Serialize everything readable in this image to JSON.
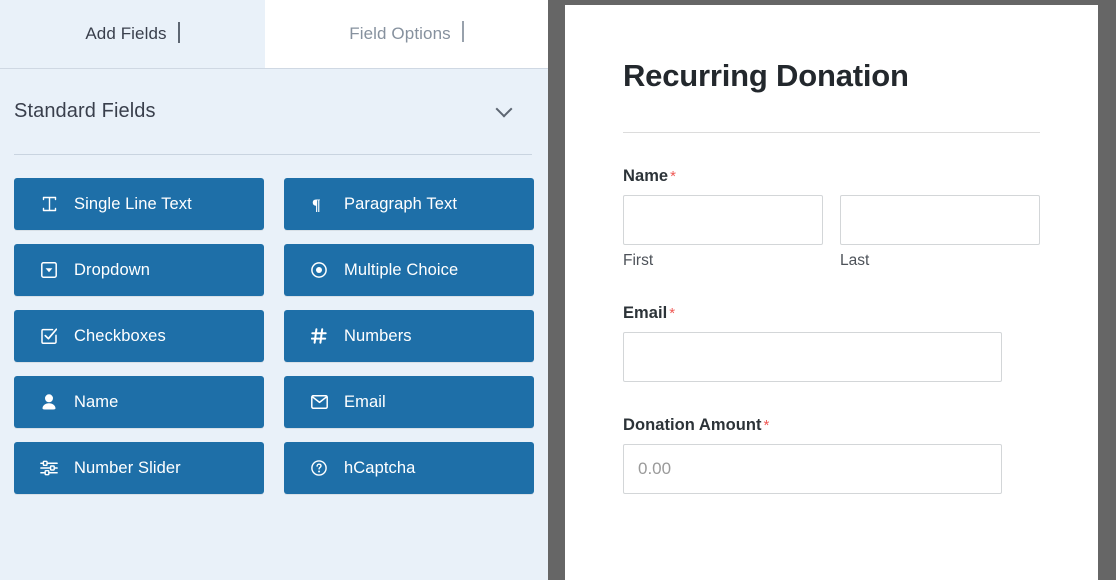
{
  "builder": {
    "tabs": [
      {
        "label": "Add Fields",
        "icon": "chevron-down-icon",
        "active": true
      },
      {
        "label": "Field Options",
        "icon": "chevron-right-icon",
        "active": false
      }
    ],
    "section": {
      "title": "Standard Fields",
      "toggle_icon": "chevron-down-icon"
    },
    "fields": [
      {
        "label": "Single Line Text",
        "icon": "text-cursor-icon"
      },
      {
        "label": "Paragraph Text",
        "icon": "pilcrow-icon"
      },
      {
        "label": "Dropdown",
        "icon": "dropdown-caret-box-icon"
      },
      {
        "label": "Multiple Choice",
        "icon": "radio-button-icon"
      },
      {
        "label": "Checkboxes",
        "icon": "checkbox-checked-icon"
      },
      {
        "label": "Numbers",
        "icon": "hash-icon"
      },
      {
        "label": "Name",
        "icon": "user-icon"
      },
      {
        "label": "Email",
        "icon": "envelope-icon"
      },
      {
        "label": "Number Slider",
        "icon": "sliders-icon"
      },
      {
        "label": "hCaptcha",
        "icon": "question-circle-icon"
      }
    ]
  },
  "preview": {
    "form_title": "Recurring Donation",
    "required_marker": "*",
    "fields": {
      "name": {
        "label": "Name",
        "required": true,
        "first": {
          "value": "",
          "sublabel": "First"
        },
        "last": {
          "value": "",
          "sublabel": "Last"
        }
      },
      "email": {
        "label": "Email",
        "required": true,
        "value": ""
      },
      "donation_amount": {
        "label": "Donation Amount",
        "required": true,
        "value": "",
        "placeholder": "0.00"
      }
    }
  },
  "colors": {
    "field_button_blue": "#1e6fa8",
    "panel_background": "#e9f1f9",
    "gutter_gray": "#666666",
    "required_red": "#ef5854",
    "title_dark": "#23282d"
  }
}
